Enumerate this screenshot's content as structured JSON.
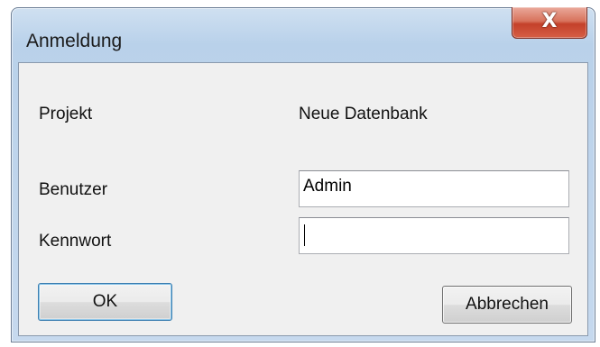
{
  "window": {
    "title": "Anmeldung",
    "close_icon": "close-icon",
    "close_glyph": "X"
  },
  "form": {
    "project_label": "Projekt",
    "project_value": "Neue Datenbank",
    "user_label": "Benutzer",
    "user_value": "Admin",
    "password_label": "Kennwort",
    "password_value": ""
  },
  "buttons": {
    "ok_label": "OK",
    "cancel_label": "Abbrechen"
  },
  "colors": {
    "close_button": "#c4412a",
    "frame": "#b9d1ea"
  }
}
